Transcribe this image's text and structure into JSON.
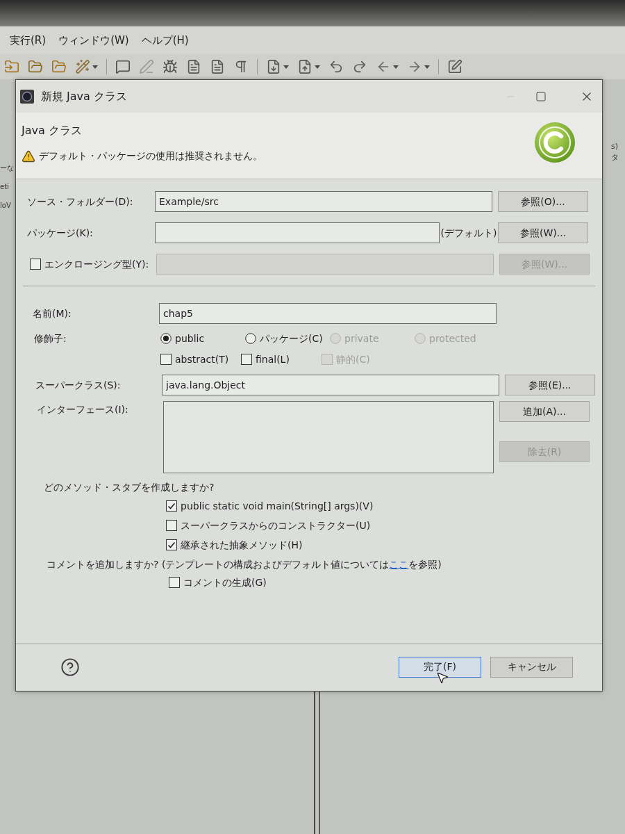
{
  "menu_bar": {
    "items": [
      "実行(R)",
      "ウィンドウ(W)",
      "ヘルプ(H)"
    ]
  },
  "background_text": {
    "left": [
      "ーな",
      "eti",
      "loV"
    ],
    "right": [
      "s)",
      "タ"
    ]
  },
  "dialog": {
    "title": "新規 Java クラス",
    "header": {
      "title": "Java クラス",
      "message": "デフォルト・パッケージの使用は推奨されません。"
    },
    "source_folder": {
      "label": "ソース・フォルダー(D):",
      "value": "Example/src",
      "button": {
        "label": "参照(O)...",
        "disabled": false
      }
    },
    "package": {
      "label": "パッケージ(K):",
      "note": "(デフォルト)",
      "button": {
        "label": "参照(W)...",
        "disabled": false
      }
    },
    "enclosing_type": {
      "label": "エンクロージング型(Y):",
      "checked": false,
      "field_disabled": true,
      "button": {
        "label": "参照(W)...",
        "disabled": true
      }
    },
    "name": {
      "label": "名前(M):",
      "value": "chap5"
    },
    "modifiers": {
      "label": "修飾子:",
      "radios": [
        {
          "label": "public",
          "selected": true,
          "disabled": false
        },
        {
          "label": "パッケージ(C)",
          "selected": false,
          "disabled": false
        },
        {
          "label": "private",
          "selected": false,
          "disabled": true
        },
        {
          "label": "protected",
          "selected": false,
          "disabled": true
        }
      ],
      "checkboxes": [
        {
          "label": "abstract(T)",
          "checked": false,
          "disabled": false
        },
        {
          "label": "final(L)",
          "checked": false,
          "disabled": false
        },
        {
          "label": "静的(C)",
          "checked": false,
          "disabled": true
        }
      ]
    },
    "superclass": {
      "label": "スーパークラス(S):",
      "value": "java.lang.Object",
      "button": {
        "label": "参照(E)...",
        "disabled": false
      }
    },
    "interfaces": {
      "label": "インターフェース(I):",
      "buttons": [
        {
          "label": "追加(A)...",
          "disabled": false
        },
        {
          "label": "除去(R)",
          "disabled": true
        }
      ]
    },
    "method_stubs": {
      "question": "どのメソッド・スタブを作成しますか?",
      "options": [
        {
          "label": "public static void main(String[] args)(V)",
          "checked": true
        },
        {
          "label": "スーパークラスからのコンストラクター(U)",
          "checked": false
        },
        {
          "label": "継承された抽象メソッド(H)",
          "checked": true
        }
      ]
    },
    "comments": {
      "question": {
        "before": "コメントを追加しますか? (テンプレートの構成およびデフォルト値については",
        "link": "ここ",
        "after": "を参照)"
      },
      "options": [
        {
          "label": "コメントの生成(G)",
          "checked": false
        }
      ]
    },
    "footer": {
      "buttons": [
        {
          "label": "完了(F)",
          "default": true
        },
        {
          "label": "キャンセル",
          "default": false
        }
      ]
    }
  }
}
